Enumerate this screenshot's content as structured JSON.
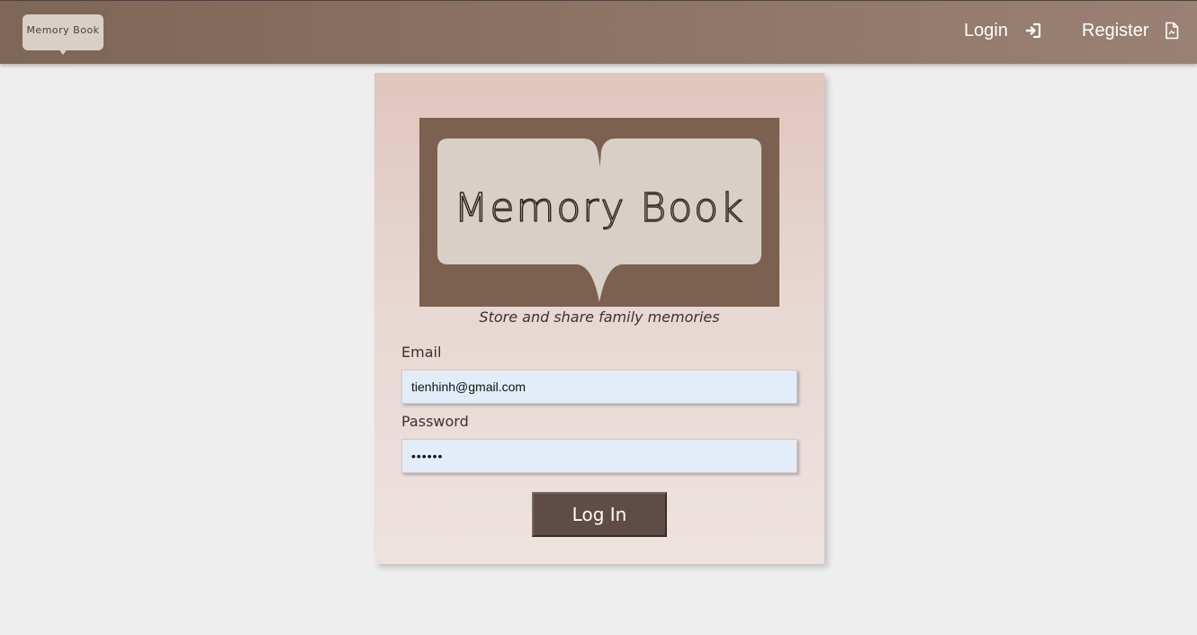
{
  "nav": {
    "logo_text": "Memory Book",
    "login_label": "Login",
    "register_label": "Register"
  },
  "hero": {
    "logo_text": "Memory Book",
    "tagline": "Store and share family memories"
  },
  "form": {
    "email_label": "Email",
    "email_value": "tienhinh@gmail.com",
    "password_label": "Password",
    "password_value": "••••••",
    "submit_label": "Log In"
  },
  "icons": {
    "login": "sign-in-icon",
    "register": "file-icon"
  },
  "colors": {
    "nav_brown": "#8f7668",
    "logo_brown": "#7c6150",
    "book_cream": "#d8cfc7",
    "button_brown": "#5f4c46",
    "input_blue": "#e2edf9",
    "page_bg": "#eeeeee"
  }
}
